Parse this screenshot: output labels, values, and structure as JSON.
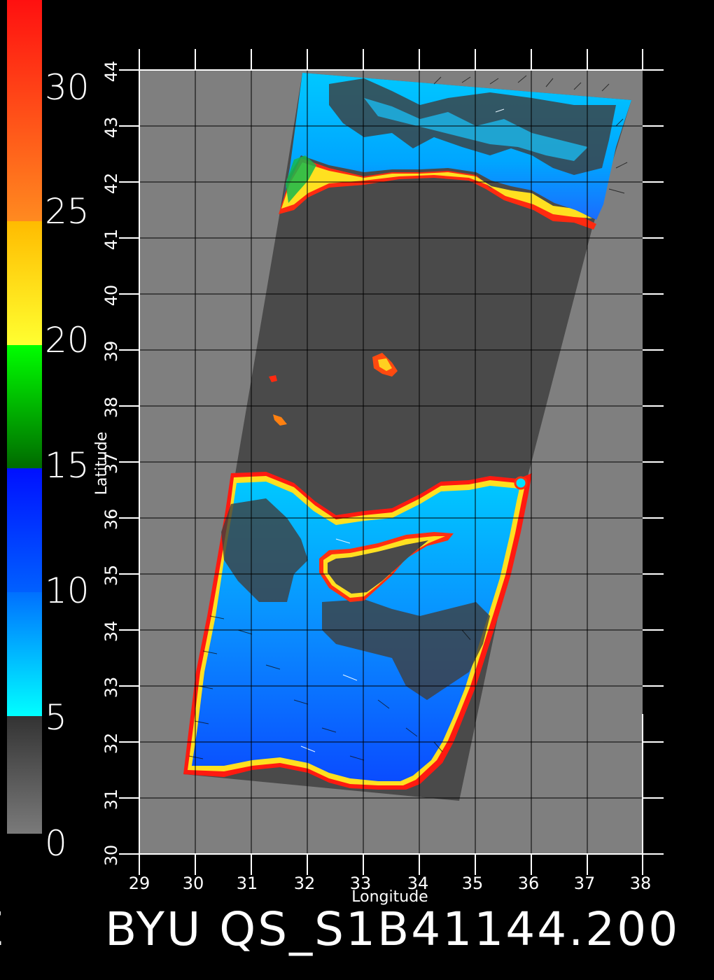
{
  "footer": {
    "left_char": "E",
    "title": "BYU QS_S1B41144.200"
  },
  "axes": {
    "x_title": "Longitude",
    "y_title": "Latitude",
    "x_ticks": [
      "29",
      "30",
      "31",
      "32",
      "33",
      "34",
      "35",
      "36",
      "37",
      "38"
    ],
    "y_ticks": [
      "30",
      "31",
      "32",
      "33",
      "34",
      "35",
      "36",
      "37",
      "38",
      "39",
      "40",
      "41",
      "42",
      "43",
      "44"
    ],
    "xlim": [
      29,
      38
    ],
    "ylim": [
      30,
      44
    ],
    "grid": true
  },
  "color_scale": {
    "labels": [
      "30",
      "25",
      "20",
      "15",
      "10",
      "5",
      "0"
    ],
    "range": [
      0,
      30
    ],
    "colors": {
      "0_5": "#7a7a7a to #3a3a3a",
      "5_10": "#00ffff to #0090ff",
      "10_15": "#0060ff to #0010ff",
      "15_20": "#007000 to #00ff00",
      "20_25": "#ffff30 to #ffbb00",
      "25_30": "#ff9020 to #ff1010"
    }
  },
  "map": {
    "background": "#7f7f7f",
    "swath_no_data": "#4a4a4a",
    "land_color": "#4a4a4a",
    "water_colors": [
      "#00e0ff",
      "#00b4ff",
      "#1870ff",
      "#0a3cff"
    ]
  }
}
